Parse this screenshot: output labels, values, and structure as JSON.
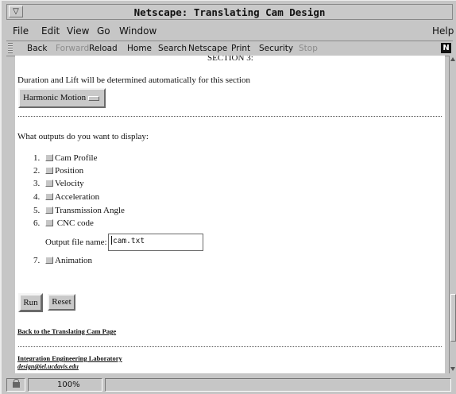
{
  "window": {
    "title": "Netscape: Translating Cam Design",
    "menu_glyph": "▽"
  },
  "menu": {
    "file": "File",
    "edit": "Edit",
    "view": "View",
    "go": "Go",
    "window": "Window",
    "help": "Help"
  },
  "toolbar": {
    "back": "Back",
    "forward": "Forward",
    "reload": "Reload",
    "home": "Home",
    "search": "Search",
    "netscape": "Netscape",
    "print": "Print",
    "security": "Security",
    "stop": "Stop",
    "logo": "N"
  },
  "page": {
    "section_heading": "SECTION 3:",
    "duration_text": "Duration and Lift will be determined automatically for this section",
    "motion_select": "Harmonic Motion",
    "outputs_prompt": "What outputs do you want to display:",
    "outputs": [
      {
        "num": "1.",
        "label": "Cam Profile"
      },
      {
        "num": "2.",
        "label": "Position"
      },
      {
        "num": "3.",
        "label": "Velocity"
      },
      {
        "num": "4.",
        "label": "Acceleration"
      },
      {
        "num": "5.",
        "label": "Transmission Angle"
      },
      {
        "num": "6.",
        "label": "CNC code"
      },
      {
        "num": "7.",
        "label": "Animation"
      }
    ],
    "output_file_label": "Output file name:",
    "output_file_value": "cam.txt",
    "run_button": "Run",
    "reset_button": "Reset",
    "back_link": "Back to the Translating Cam Page",
    "lab_name": "Integration Engineering Laboratory",
    "lab_email": "design@iel.ucdavis.edu"
  },
  "status": {
    "zoom": "100%"
  }
}
